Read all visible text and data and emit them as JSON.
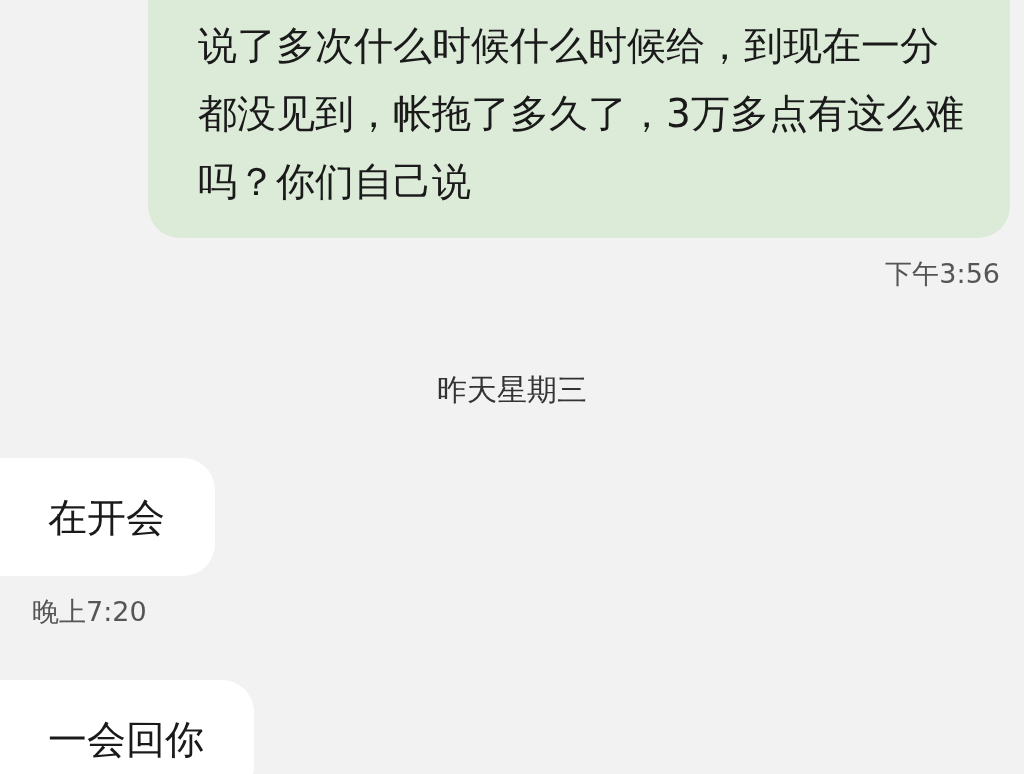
{
  "messages": [
    {
      "kind": "sent",
      "text": "说了多次什么时候什么时候给，到现在一分都没见到，帐拖了多久了，3万多点有这么难吗？你们自己说",
      "time": "下午3:56"
    },
    {
      "kind": "date",
      "text": "昨天星期三"
    },
    {
      "kind": "received",
      "text": "在开会",
      "time": "晚上7:20"
    },
    {
      "kind": "received",
      "text": "一会回你"
    }
  ]
}
